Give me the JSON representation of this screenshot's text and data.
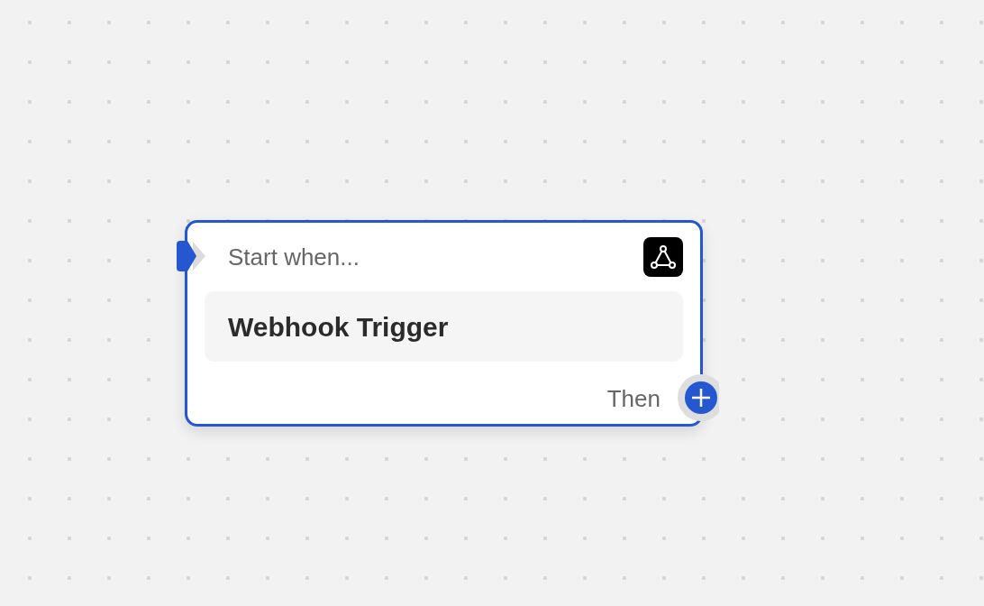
{
  "node": {
    "selected": true,
    "header": "Start when...",
    "title": "Webhook Trigger",
    "footer": "Then"
  }
}
